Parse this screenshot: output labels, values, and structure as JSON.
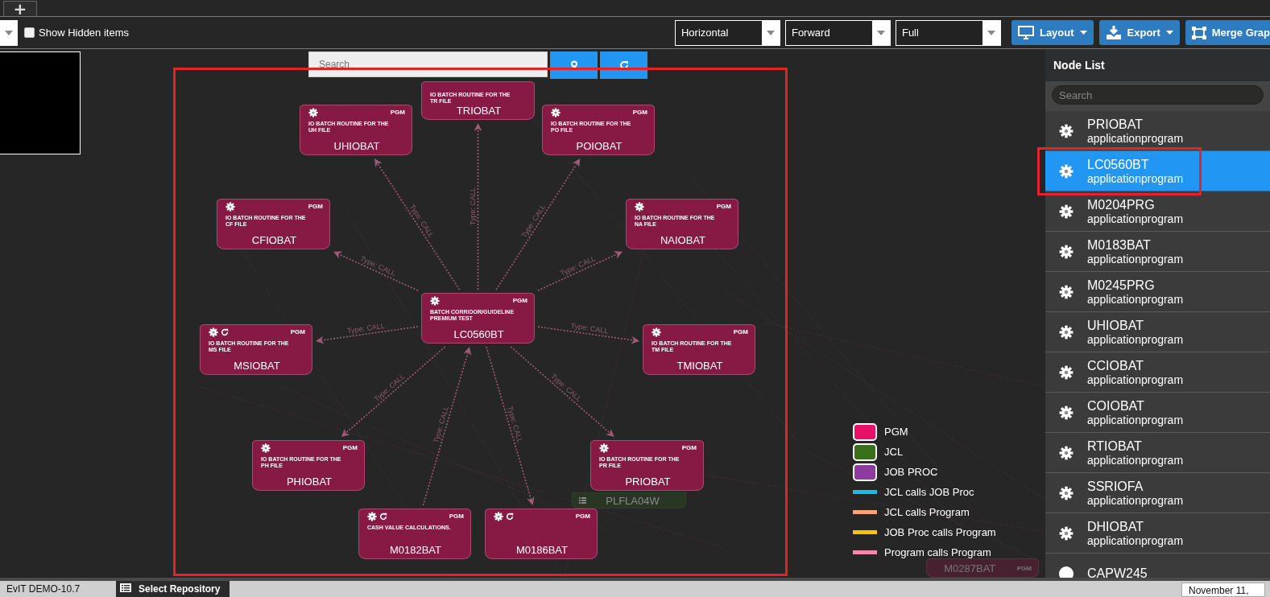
{
  "top_tabs": {
    "add_label": "+"
  },
  "toolbar": {
    "show_hidden": {
      "label": "Show Hidden items",
      "checked": false
    },
    "selects": [
      {
        "value": "Horizontal"
      },
      {
        "value": "Forward"
      },
      {
        "value": "Full"
      }
    ],
    "buttons": [
      {
        "label": "Layout",
        "kind": "monitor"
      },
      {
        "label": "Export",
        "kind": "download"
      },
      {
        "label": "Merge Grap",
        "kind": "merge"
      }
    ]
  },
  "graph": {
    "search": {
      "placeholder": "Search"
    },
    "nodes": [
      {
        "name": "TRIOBAT",
        "description": "IO BATCH ROUTINE FOR THE TR FILE",
        "kind": "pgm",
        "edge_label": "Type: CALL",
        "incoming": false,
        "dimmed": false
      },
      {
        "name": "UHIOBAT",
        "type_label": "PGM",
        "description": "IO BATCH ROUTINE FOR THE UH FILE",
        "kind": "pgm",
        "edge_label": "Type: CALL",
        "incoming": false,
        "dimmed": false,
        "looped": false
      },
      {
        "name": "POIOBAT",
        "type_label": "PGM",
        "description": "IO BATCH ROUTINE FOR THE PO FILE",
        "kind": "pgm",
        "edge_label": "Type: CALL",
        "incoming": false,
        "dimmed": false,
        "looped": false
      },
      {
        "name": "CFIOBAT",
        "type_label": "PGM",
        "description": "IO BATCH ROUTINE FOR THE CF FILE",
        "kind": "pgm",
        "edge_label": "Type: CALL",
        "incoming": false,
        "dimmed": false,
        "looped": false
      },
      {
        "name": "NAIOBAT",
        "type_label": "PGM",
        "description": "IO BATCH ROUTINE FOR THE NA FILE",
        "kind": "pgm",
        "edge_label": "Type: CALL",
        "incoming": false,
        "dimmed": false,
        "looped": false
      },
      {
        "name": "LC0560BT",
        "type_label": "PGM",
        "description": "BATCH CORRIDOR/GUIDELINE PREMIUM TEST",
        "kind": "hub",
        "dimmed": false,
        "looped": false
      },
      {
        "name": "MSIOBAT",
        "type_label": "PGM",
        "description": "IO BATCH ROUTINE FOR THE MS FILE",
        "kind": "pgm",
        "edge_label": "Type: CALL",
        "incoming": false,
        "dimmed": false,
        "looped": true
      },
      {
        "name": "TMIOBAT",
        "type_label": "PGM",
        "description": "IO BATCH ROUTINE FOR THE TM FILE",
        "kind": "pgm",
        "edge_label": "Type: CALL",
        "incoming": false,
        "dimmed": false,
        "looped": false
      },
      {
        "name": "PHIOBAT",
        "type_label": "PGM",
        "description": "IO BATCH ROUTINE FOR THE PH FILE",
        "kind": "pgm",
        "edge_label": "Type: CALL",
        "incoming": false,
        "dimmed": false,
        "looped": false
      },
      {
        "name": "PRIOBAT",
        "type_label": "PGM",
        "description": "IO BATCH ROUTINE FOR THE PR FILE",
        "kind": "pgm",
        "edge_label": "Type: CALL",
        "incoming": false,
        "dimmed": false,
        "looped": false
      },
      {
        "name": "PLFLA04W",
        "kind": "jcl",
        "dimmed": true
      },
      {
        "name": "M0182BAT",
        "type_label": "PGM",
        "description": "CASH VALUE CALCULATIONS.",
        "kind": "pgm",
        "edge_label": "Type: CALL",
        "incoming": true,
        "dimmed": false,
        "looped": true
      },
      {
        "name": "M0186BAT",
        "type_label": "PGM",
        "kind": "pgm",
        "edge_label": "Type: CALL",
        "incoming": false,
        "dimmed": false,
        "looped": true
      },
      {
        "name": "M0287BAT",
        "type_label": "PGM",
        "kind": "pgm",
        "dimmed": true
      }
    ],
    "legend": [
      {
        "label": "PGM",
        "kind": "node",
        "color": "#e8116a"
      },
      {
        "label": "JCL",
        "kind": "node",
        "color": "#38701a"
      },
      {
        "label": "JOB PROC",
        "kind": "node",
        "color": "#8e3aa0"
      },
      {
        "label": "JCL calls JOB Proc",
        "kind": "edge",
        "color": "#1ab9f2"
      },
      {
        "label": "JCL calls Program",
        "kind": "edge",
        "color": "#f6a27c"
      },
      {
        "label": "JOB Proc calls Program",
        "kind": "edge",
        "color": "#ffc107"
      },
      {
        "label": "Program calls Program",
        "kind": "edge",
        "color": "#f08aa8"
      }
    ]
  },
  "node_list": {
    "title": "Node List",
    "search": {
      "placeholder": "Search"
    },
    "items": [
      {
        "name": "PRIOBAT",
        "type": "applicationprogram",
        "kind": "gear",
        "selected": false
      },
      {
        "name": "LC0560BT",
        "type": "applicationprogram",
        "kind": "gear",
        "selected": true
      },
      {
        "name": "M0204PRG",
        "type": "applicationprogram",
        "kind": "gear",
        "selected": false
      },
      {
        "name": "M0183BAT",
        "type": "applicationprogram",
        "kind": "gear",
        "selected": false
      },
      {
        "name": "M0245PRG",
        "type": "applicationprogram",
        "kind": "gear",
        "selected": false
      },
      {
        "name": "UHIOBAT",
        "type": "applicationprogram",
        "kind": "gear",
        "selected": false
      },
      {
        "name": "CCIOBAT",
        "type": "applicationprogram",
        "kind": "gear",
        "selected": false
      },
      {
        "name": "COIOBAT",
        "type": "applicationprogram",
        "kind": "gear",
        "selected": false
      },
      {
        "name": "RTIOBAT",
        "type": "applicationprogram",
        "kind": "gear",
        "selected": false
      },
      {
        "name": "SSRIOFA",
        "type": "applicationprogram",
        "kind": "gear",
        "selected": false
      },
      {
        "name": "DHIOBAT",
        "type": "applicationprogram",
        "kind": "gear",
        "selected": false
      },
      {
        "name": "CAPW245",
        "kind": "dot",
        "selected": false
      }
    ]
  },
  "status_bar": {
    "repository": "EvIT DEMO-10.7",
    "tab": "Select Repository",
    "date": "November 11,"
  }
}
